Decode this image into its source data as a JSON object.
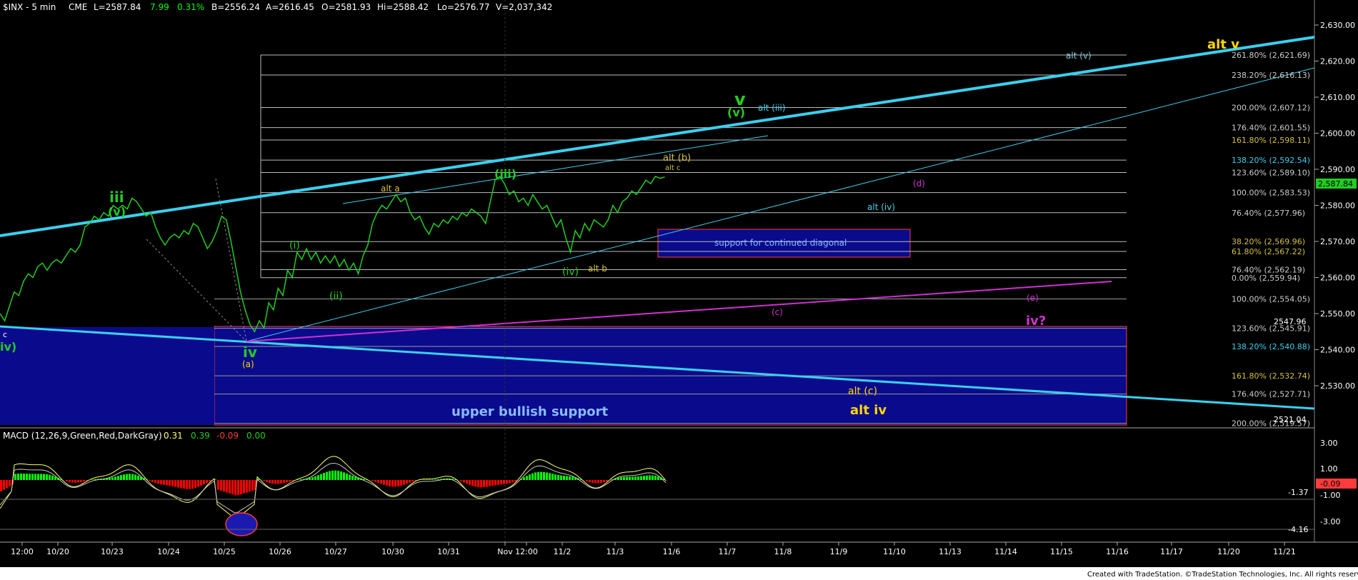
{
  "header": {
    "symbol": "$INX - 5 min",
    "exchange": "CME",
    "last": "L=2587.84",
    "change": "7.99",
    "change_pct": "0.31%",
    "bid": "B=2556.24",
    "ask": "A=2616.45",
    "open": "O=2581.93",
    "high": "Hi=2588.42",
    "low": "Lo=2576.77",
    "volume": "V=2,037,342"
  },
  "macd": {
    "title": "MACD (12,26,9,Green,Red,DarkGray)",
    "v1": "0.31",
    "v2": "0.39",
    "v3": "-0.09",
    "v4": "0.00",
    "axis_ticks": [
      "3.00",
      "1.00",
      "-1.00",
      "-3.00"
    ],
    "level_labels": [
      "-1.37",
      "-4.16"
    ],
    "last_value": "-0.09",
    "colors": {
      "hist_pos": "#00ff00",
      "hist_neg": "#ff0000",
      "line1": "#ffff66",
      "line2": "#c8c8c8"
    }
  },
  "footer": {
    "credit": "Created with TradeStation. ©TradeStation Technologies, Inc. All rights reserved."
  },
  "labels": {
    "alt_v": "alt v",
    "alt_paren_v": "alt (v)",
    "big_v": "v",
    "paren_v_green": "(v)",
    "alt_iii": "alt (iii)",
    "alt_b": "alt (b)",
    "alt_c_small": "alt c",
    "alt_a": "alt a",
    "iii_label": "(iii)",
    "iii_roman": "iii",
    "v_under_iii": "(v)",
    "i_label": "(i)",
    "ii_label": "(ii)",
    "iv_small": "(iv)",
    "alt_b_small": "alt b",
    "iv_roman": "iv",
    "a_label": "(a)",
    "c_small": "c",
    "left_iv": "iv)",
    "d_label": "(d)",
    "alt_iv_paren": "alt (iv)",
    "e_label": "(e)",
    "c_label": "(c)",
    "iv_question": "iv?",
    "alt_c_paren": "alt (c)",
    "alt_iv": "alt iv",
    "support_box": "support for continued diagonal",
    "upper_support": "upper bullish support",
    "level_2547": "2547.96",
    "level_2521": "2521.04"
  },
  "fib_labels": [
    "261.80% (2,621.69)",
    "238.20% (2,616.13)",
    "200.00% (2,607.12)",
    "176.40% (2,601.55)",
    "161.80% (2,598.11)",
    "138.20% (2,592.54)",
    "123.60% (2,589.10)",
    "100.00% (2,583.53)",
    "76.40% (2,577.96)",
    "38.20% (2,569.96)",
    "61.80% (2,567.22)",
    "76.40% (2,562.19)",
    "0.00% (2,559.94)",
    "100.00% (2,554.05)",
    "123.60% (2,545.91)",
    "138.20% (2,540.88)",
    "161.80% (2,532.74)",
    "176.40% (2,527.71)",
    "200.00% (2,519.57)"
  ],
  "chart_data": {
    "type": "line",
    "title": "$INX - 5 min",
    "y_ticks": [
      2630,
      2620,
      2610,
      2600,
      2590,
      2580,
      2570,
      2560,
      2550,
      2540,
      2530
    ],
    "y_tick_labels": [
      "2,630.00",
      "2,620.00",
      "2,610.00",
      "2,600.00",
      "2,590.00",
      "2,580.00",
      "2,570.00",
      "2,560.00",
      "2,550.00",
      "2,540.00",
      "2,530.00"
    ],
    "ylim": [
      2521,
      2636
    ],
    "last_price": "2,587.84",
    "x_tick_labels": [
      "12:00",
      "10/20",
      "10/23",
      "10/24",
      "10/25",
      "10/26",
      "10/27",
      "10/30",
      "10/31",
      "Nov",
      "12:00",
      "11/2",
      "11/3",
      "11/6",
      "11/7",
      "11/8",
      "11/9",
      "11/10",
      "11/13",
      "11/14",
      "11/15",
      "11/16",
      "11/17",
      "11/20",
      "11/21"
    ],
    "price_series": [
      [
        0,
        2550
      ],
      [
        3,
        2548
      ],
      [
        6,
        2552
      ],
      [
        9,
        2556
      ],
      [
        12,
        2555
      ],
      [
        15,
        2559
      ],
      [
        18,
        2561
      ],
      [
        21,
        2560
      ],
      [
        24,
        2563
      ],
      [
        27,
        2564
      ],
      [
        30,
        2562
      ],
      [
        33,
        2564
      ],
      [
        36,
        2565
      ],
      [
        39,
        2564
      ],
      [
        42,
        2566
      ],
      [
        45,
        2568
      ],
      [
        48,
        2567
      ],
      [
        51,
        2569
      ],
      [
        54,
        2574
      ],
      [
        57,
        2575
      ],
      [
        60,
        2577
      ],
      [
        63,
        2576
      ],
      [
        66,
        2578
      ],
      [
        69,
        2577
      ],
      [
        72,
        2580
      ],
      [
        75,
        2579
      ],
      [
        78,
        2580
      ],
      [
        81,
        2579
      ],
      [
        84,
        2582
      ],
      [
        87,
        2581
      ],
      [
        90,
        2579
      ],
      [
        93,
        2577
      ],
      [
        96,
        2578
      ],
      [
        99,
        2574
      ],
      [
        102,
        2571
      ],
      [
        105,
        2569
      ],
      [
        108,
        2571
      ],
      [
        111,
        2572
      ],
      [
        114,
        2571
      ],
      [
        117,
        2573
      ],
      [
        120,
        2572
      ],
      [
        123,
        2575
      ],
      [
        126,
        2574
      ],
      [
        129,
        2571
      ],
      [
        132,
        2568
      ],
      [
        135,
        2570
      ],
      [
        138,
        2573
      ],
      [
        141,
        2577
      ],
      [
        144,
        2576
      ],
      [
        147,
        2570
      ],
      [
        150,
        2563
      ],
      [
        153,
        2556
      ],
      [
        156,
        2551
      ],
      [
        159,
        2547
      ],
      [
        162,
        2545
      ],
      [
        165,
        2548
      ],
      [
        168,
        2546
      ],
      [
        171,
        2553
      ],
      [
        174,
        2551
      ],
      [
        177,
        2557
      ],
      [
        180,
        2555
      ],
      [
        183,
        2562
      ],
      [
        186,
        2560
      ],
      [
        189,
        2567
      ],
      [
        192,
        2565
      ],
      [
        195,
        2568
      ],
      [
        198,
        2565
      ],
      [
        201,
        2567
      ],
      [
        204,
        2564
      ],
      [
        207,
        2566
      ],
      [
        210,
        2564
      ],
      [
        213,
        2566
      ],
      [
        216,
        2563
      ],
      [
        219,
        2565
      ],
      [
        222,
        2562
      ],
      [
        225,
        2564
      ],
      [
        228,
        2561
      ],
      [
        231,
        2566
      ],
      [
        234,
        2569
      ],
      [
        237,
        2575
      ],
      [
        240,
        2578
      ],
      [
        243,
        2580
      ],
      [
        246,
        2579
      ],
      [
        249,
        2581
      ],
      [
        252,
        2583
      ],
      [
        255,
        2581
      ],
      [
        258,
        2582
      ],
      [
        261,
        2578
      ],
      [
        264,
        2576
      ],
      [
        267,
        2577
      ],
      [
        270,
        2574
      ],
      [
        273,
        2572
      ],
      [
        276,
        2575
      ],
      [
        279,
        2574
      ],
      [
        282,
        2576
      ],
      [
        285,
        2575
      ],
      [
        288,
        2577
      ],
      [
        291,
        2576
      ],
      [
        294,
        2578
      ],
      [
        297,
        2577
      ],
      [
        300,
        2579
      ],
      [
        303,
        2578
      ],
      [
        306,
        2577
      ],
      [
        309,
        2575
      ],
      [
        312,
        2581
      ],
      [
        315,
        2587
      ],
      [
        318,
        2588
      ],
      [
        321,
        2586
      ],
      [
        324,
        2583
      ],
      [
        327,
        2584
      ],
      [
        330,
        2581
      ],
      [
        333,
        2582
      ],
      [
        336,
        2580
      ],
      [
        339,
        2583
      ],
      [
        342,
        2581
      ],
      [
        345,
        2579
      ],
      [
        348,
        2580
      ],
      [
        351,
        2577
      ],
      [
        354,
        2574
      ],
      [
        357,
        2576
      ],
      [
        360,
        2571
      ],
      [
        363,
        2567
      ],
      [
        366,
        2573
      ],
      [
        369,
        2571
      ],
      [
        372,
        2575
      ],
      [
        375,
        2573
      ],
      [
        378,
        2576
      ],
      [
        381,
        2575
      ],
      [
        384,
        2574
      ],
      [
        387,
        2576
      ],
      [
        390,
        2580
      ],
      [
        393,
        2578
      ],
      [
        396,
        2581
      ],
      [
        399,
        2582
      ],
      [
        402,
        2584
      ],
      [
        405,
        2583
      ],
      [
        408,
        2585
      ],
      [
        411,
        2587
      ],
      [
        414,
        2586
      ],
      [
        417,
        2588
      ],
      [
        420,
        2587.5
      ],
      [
        423,
        2587.84
      ]
    ]
  }
}
